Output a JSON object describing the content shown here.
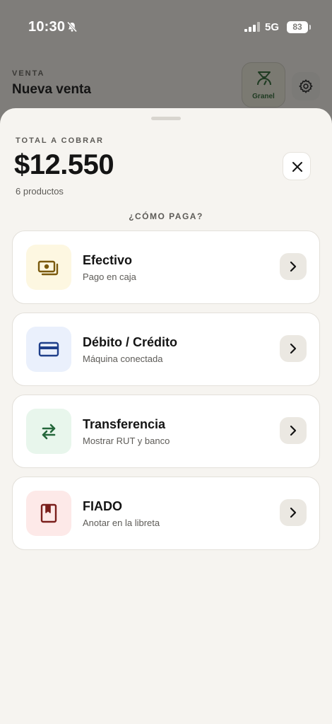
{
  "status_bar": {
    "time": "10:30",
    "network": "5G",
    "battery": "83"
  },
  "background": {
    "kicker": "VENTA",
    "title": "Nueva venta",
    "granel_label": "Granel"
  },
  "sheet": {
    "total_kicker": "TOTAL A COBRAR",
    "total_amount": "$12.550",
    "product_count": "6 productos",
    "how_label": "¿CÓMO PAGA?",
    "methods": [
      {
        "title": "Efectivo",
        "subtitle": "Pago en caja",
        "icon": "cash-icon",
        "icon_bg": "#fdf7e1",
        "icon_color": "#7a5a0e"
      },
      {
        "title": "Débito / Crédito",
        "subtitle": "Máquina conectada",
        "icon": "card-icon",
        "icon_bg": "#eaf0fc",
        "icon_color": "#1f3f8a"
      },
      {
        "title": "Transferencia",
        "subtitle": "Mostrar RUT y banco",
        "icon": "transfer-icon",
        "icon_bg": "#e8f6ec",
        "icon_color": "#24673b"
      },
      {
        "title": "FIADO",
        "subtitle": "Anotar en la libreta",
        "icon": "notebook-icon",
        "icon_bg": "#fde9e8",
        "icon_color": "#7a1f1c"
      }
    ]
  }
}
